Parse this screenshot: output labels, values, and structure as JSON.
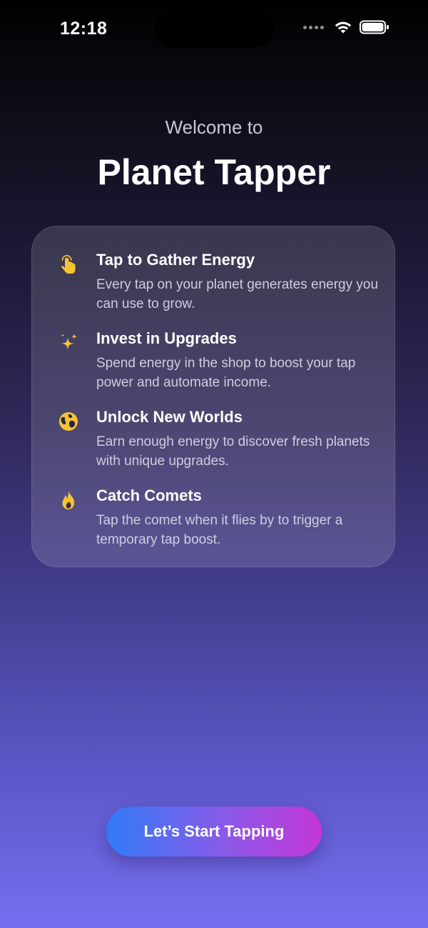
{
  "status_bar": {
    "time": "12:18"
  },
  "header": {
    "welcome": "Welcome to",
    "title": "Planet Tapper"
  },
  "features": [
    {
      "icon": "hand-tap-icon",
      "title": "Tap to Gather Energy",
      "description": "Every tap on your planet generates energy you can use to grow."
    },
    {
      "icon": "sparkles-icon",
      "title": "Invest in Upgrades",
      "description": "Spend energy in the shop to boost your tap power and automate income."
    },
    {
      "icon": "globe-icon",
      "title": "Unlock New Worlds",
      "description": "Earn enough energy to discover fresh planets with unique upgrades."
    },
    {
      "icon": "flame-icon",
      "title": "Catch Comets",
      "description": "Tap the comet when it flies by to trigger a temporary tap boost."
    }
  ],
  "cta": {
    "label": "Let’s Start Tapping"
  },
  "colors": {
    "accent_icon": "#f6c431",
    "button_start": "#2f7bf6",
    "button_end": "#c336d8"
  }
}
